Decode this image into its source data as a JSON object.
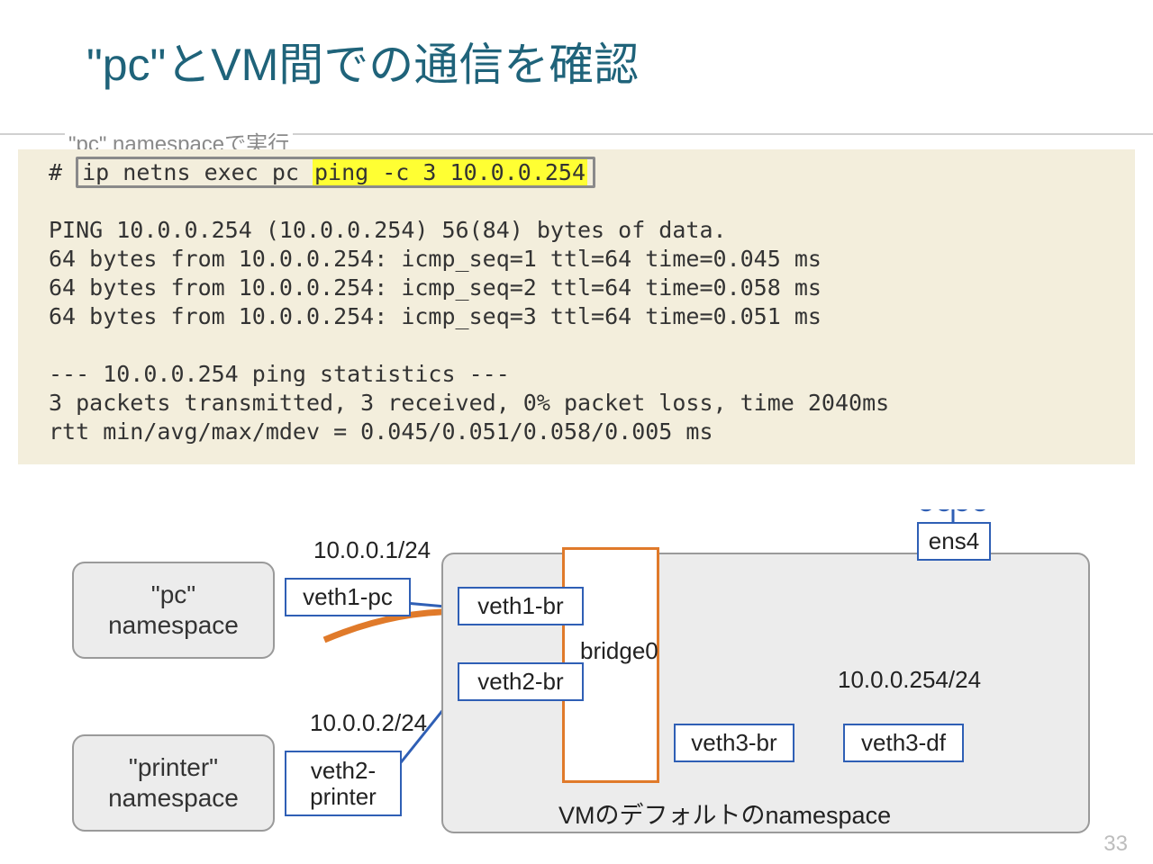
{
  "title": "\"pc\"とVM間での通信を確認",
  "caption": "\"pc\" namespaceで実行",
  "terminal": {
    "prompt": "# ",
    "cmd_prefix": "ip netns exec pc",
    "cmd_highlight": "ping -c 3 10.0.0.254",
    "out1": "PING 10.0.0.254 (10.0.0.254) 56(84) bytes of data.",
    "out2": "64 bytes from 10.0.0.254: icmp_seq=1 ttl=64 time=0.045 ms",
    "out3": "64 bytes from 10.0.0.254: icmp_seq=2 ttl=64 time=0.058 ms",
    "out4": "64 bytes from 10.0.0.254: icmp_seq=3 ttl=64 time=0.051 ms",
    "out5": "",
    "out6": "--- 10.0.0.254 ping statistics ---",
    "out7": "3 packets transmitted, 3 received, 0% packet loss, time 2040ms",
    "out8": "rtt min/avg/max/mdev = 0.045/0.051/0.058/0.005 ms"
  },
  "diagram": {
    "pc_ns_line1": "\"pc\"",
    "pc_ns_line2": "namespace",
    "printer_ns_line1": "\"printer\"",
    "printer_ns_line2": "namespace",
    "vm_ns_label": "VMのデフォルトのnamespace",
    "veth1_pc": "veth1-pc",
    "veth1_br": "veth1-br",
    "veth2_printer_l1": "veth2-",
    "veth2_printer_l2": "printer",
    "veth2_br": "veth2-br",
    "veth3_br": "veth3-br",
    "veth3_df": "veth3-df",
    "ens4": "ens4",
    "bridge0": "bridge0",
    "ip1": "10.0.0.1/24",
    "ip2": "10.0.0.2/24",
    "ip254": "10.0.0.254/24"
  },
  "page_number": "33"
}
